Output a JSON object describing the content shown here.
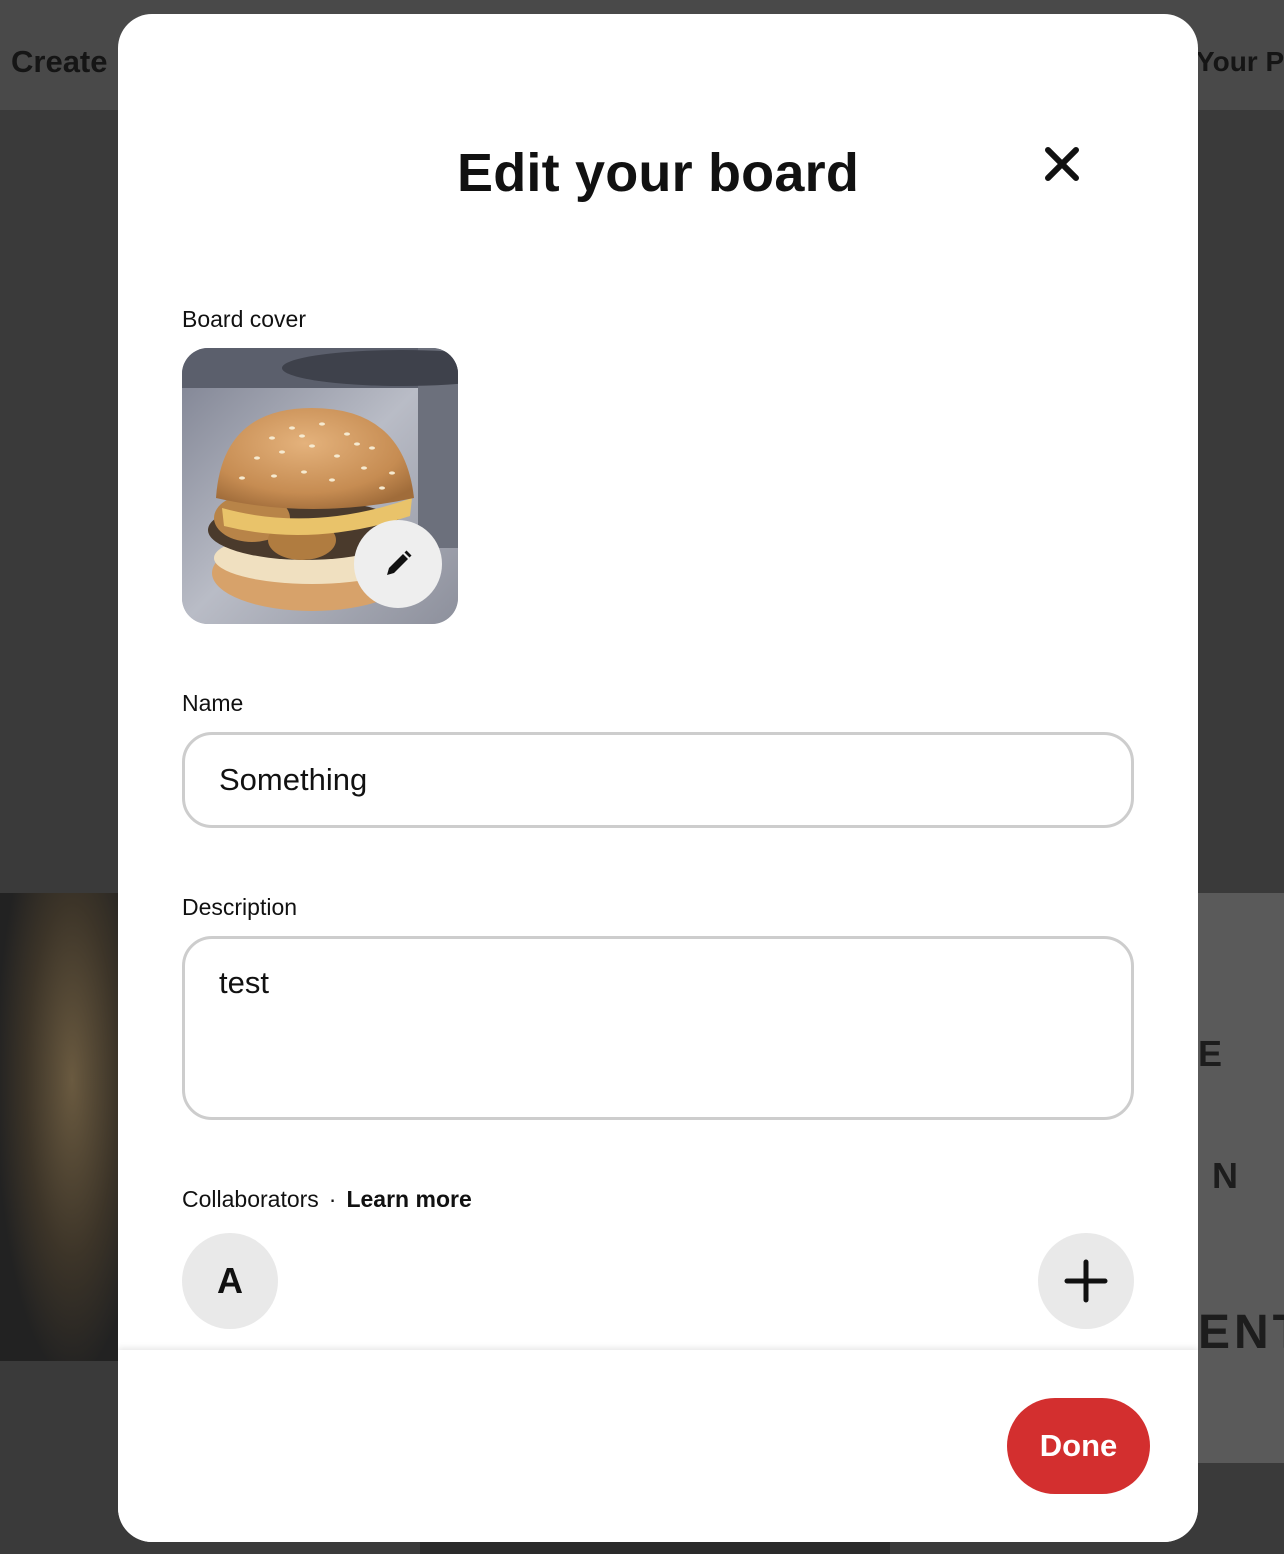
{
  "background": {
    "header_left": "Create",
    "header_right": "Your Pi",
    "letters": [
      "E",
      "N",
      "ENT"
    ]
  },
  "modal": {
    "title": "Edit your board",
    "close_icon": "close-icon",
    "board_cover": {
      "label": "Board cover",
      "edit_icon": "pencil-icon"
    },
    "name": {
      "label": "Name",
      "value": "Something"
    },
    "description": {
      "label": "Description",
      "value": "test"
    },
    "collaborators": {
      "label": "Collaborators",
      "separator": "·",
      "learn_more": "Learn more",
      "avatars": [
        "A"
      ],
      "add_icon": "plus-icon"
    },
    "done_label": "Done"
  },
  "colors": {
    "accent": "#d32f2f",
    "field_border": "#cdcdcd",
    "circle_button_bg": "#e9e9e9"
  }
}
